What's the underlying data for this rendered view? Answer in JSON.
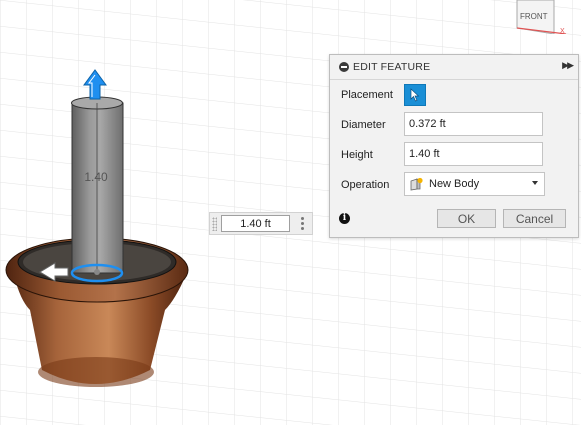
{
  "viewport": {
    "viewcube_label": "FRONT",
    "axis_x_label": "X",
    "dimension_label": "1.40",
    "height_input": {
      "value": "1.40 ft"
    }
  },
  "dialog": {
    "title": "EDIT FEATURE",
    "rows": {
      "placement": {
        "label": "Placement"
      },
      "diameter": {
        "label": "Diameter",
        "value": "0.372 ft"
      },
      "height": {
        "label": "Height",
        "value": "1.40 ft"
      },
      "operation": {
        "label": "Operation",
        "value": "New Body"
      }
    },
    "ok_label": "OK",
    "cancel_label": "Cancel"
  },
  "colors": {
    "accent": "#1a8fd6",
    "pot": "#8b4a2a",
    "soil": "#3d3833",
    "cylinder": "#8c8c8c",
    "manipulator": "#1f8ff0"
  }
}
